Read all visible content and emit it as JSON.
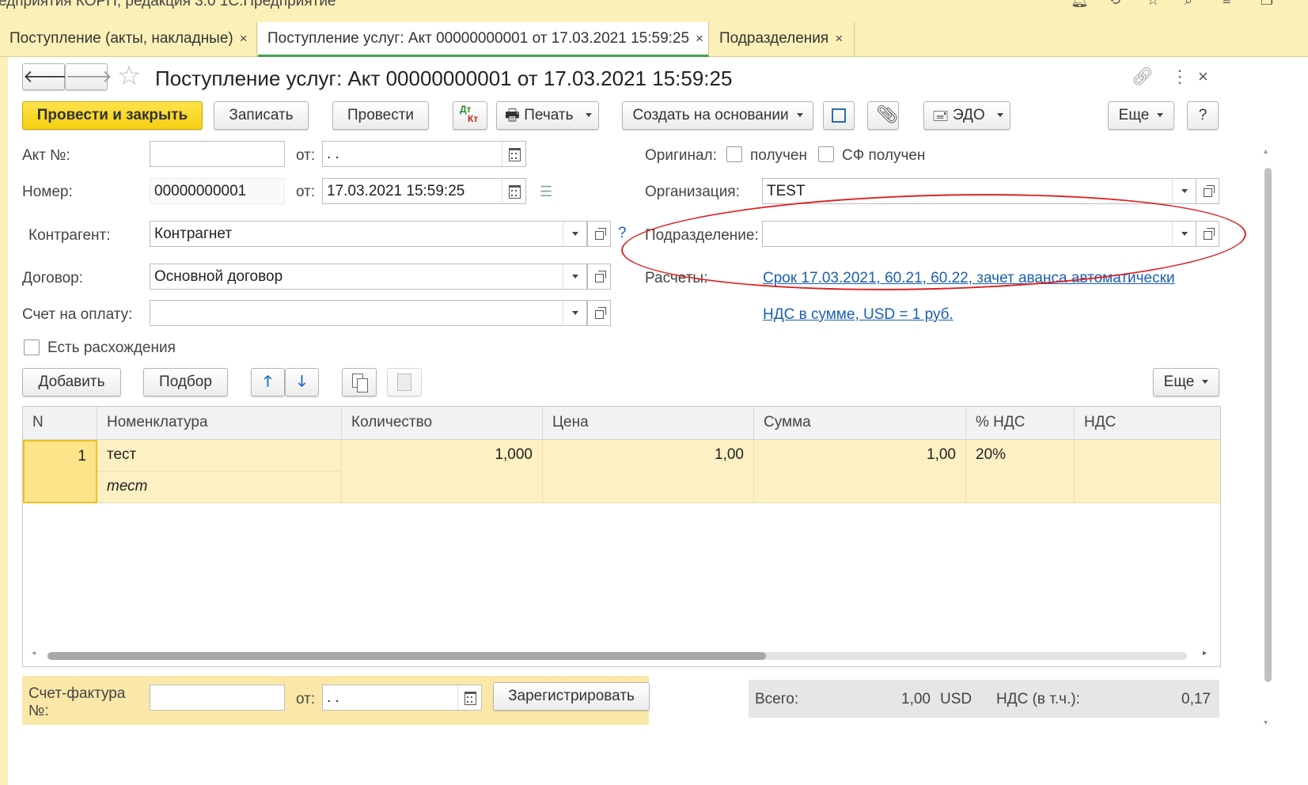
{
  "window": {
    "title": "едприятия КОРП, редакция 3.0 1С:Предприятие"
  },
  "tabs": [
    {
      "label": "Поступление (акты, накладные)",
      "close": "×"
    },
    {
      "label": "Поступление услуг: Акт 00000000001 от 17.03.2021 15:59:25",
      "close": "×"
    },
    {
      "label": "Подразделения",
      "close": "×"
    }
  ],
  "form": {
    "title": "Поступление услуг: Акт 00000000001 от 17.03.2021 15:59:25",
    "toolbar": {
      "post_close": "Провести и закрыть",
      "save": "Записать",
      "post": "Провести",
      "dtkt_dt": "Дт",
      "dtkt_kt": "Кт",
      "print": "Печать",
      "create_based": "Создать на основании",
      "edo": "ЭДО",
      "more": "Еще",
      "help": "?"
    },
    "fields": {
      "act_no_label": "Акт №:",
      "act_no_value": "",
      "from_label": "от:",
      "act_date_value": " .  .",
      "number_label": "Номер:",
      "number_value": "00000000001",
      "date_value": "17.03.2021 15:59:25",
      "counterparty_label": "Контрагент:",
      "counterparty_value": "Контрагнет",
      "question": "?",
      "contract_label": "Договор:",
      "contract_value": "Основной договор",
      "invoice_label": "Счет на оплату:",
      "invoice_value": "",
      "discrepancy_label": "Есть расхождения",
      "original_label": "Оригинал:",
      "received_label": "получен",
      "sf_received_label": "СФ получен",
      "org_label": "Организация:",
      "org_value": "TEST",
      "division_label": "Подразделение:",
      "division_value": "",
      "settlements_label": "Расчеты:",
      "settlements_link": "Срок 17.03.2021, 60.21, 60.22, зачет аванса автоматически",
      "vat_link": "НДС в сумме, USD = 1 руб."
    },
    "table_toolbar": {
      "add": "Добавить",
      "select": "Подбор",
      "more": "Еще"
    },
    "table": {
      "columns": [
        "N",
        "Номенклатура",
        "Количество",
        "Цена",
        "Сумма",
        "% НДС",
        "НДС"
      ],
      "rows": [
        {
          "n": "1",
          "item": "тест",
          "item_sub": "тест",
          "qty": "1,000",
          "price": "1,00",
          "sum": "1,00",
          "vat_rate": "20%",
          "vat": ""
        }
      ]
    },
    "footer": {
      "sf_label": "Счет-фактура №:",
      "sf_value": "",
      "from_label": "от:",
      "sf_date": " .  .",
      "register": "Зарегистрировать",
      "total_label": "Всего:",
      "total_value": "1,00",
      "currency": "USD",
      "vat_incl_label": "НДС (в т.ч.):",
      "vat_incl_value": "0,17"
    }
  }
}
